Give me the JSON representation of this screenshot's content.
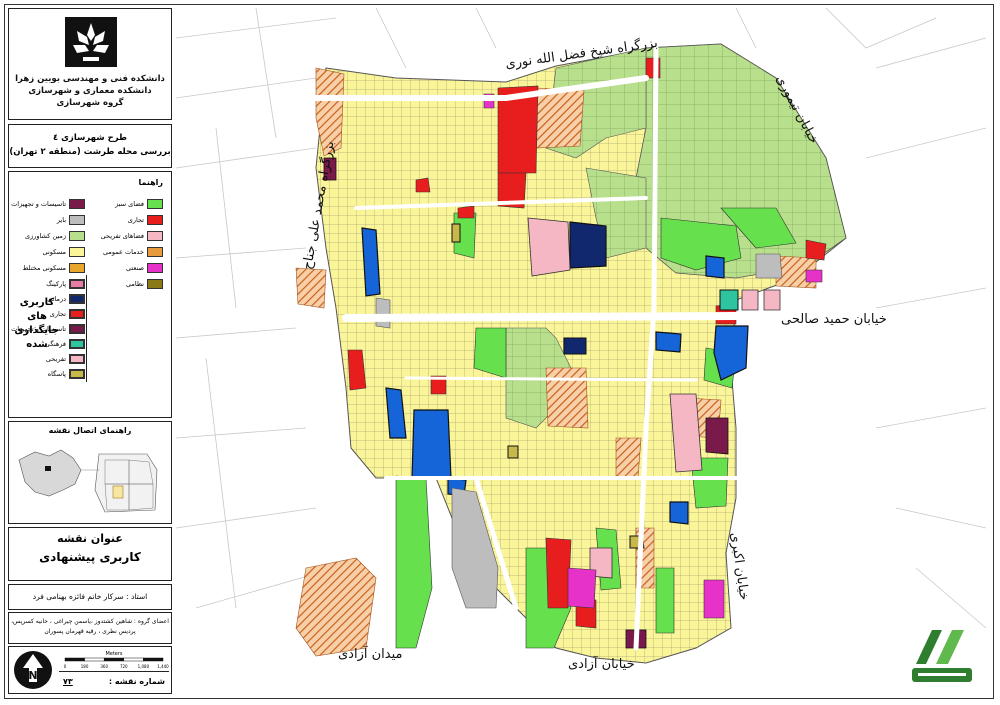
{
  "header": {
    "line1": "دانشکده فنی و مهندسی بویین زهرا",
    "line2": "دانشکده معماری و شهرسازی",
    "line3": "گروه شهرسازی"
  },
  "project": {
    "line1": "طرح شهرسازی ٤",
    "line2": "بررسی محله طرشت (منطقه ۲ تهران)"
  },
  "legend": {
    "title": "راهنما",
    "items": [
      {
        "label": "فضای سبز",
        "color": "#66e04c"
      },
      {
        "label": "تاسیسات و تجهیزات",
        "color": "#7a1a4a"
      },
      {
        "label": "تجاری",
        "color": "#e81e1e"
      },
      {
        "label": "بایر",
        "color": "#bdbdbd"
      },
      {
        "label": "فضاهای تفریحی",
        "color": "#f6b7c4"
      },
      {
        "label": "زمین کشاورزی",
        "color": "#b8e08c"
      },
      {
        "label": "خدمات عمومی",
        "color": "#e89a3c"
      },
      {
        "label": "مسکونی",
        "color": "#fbf59a"
      },
      {
        "label": "صنعتی",
        "color": "#e632c8"
      },
      {
        "label": "مسکونی مختلط",
        "color": "#e8a62c"
      },
      {
        "label": "نظامی",
        "color": "#8a7a16"
      }
    ],
    "proposed_items": [
      {
        "label": "پارکینگ",
        "color": "#e87aa6"
      },
      {
        "label": "درمانی",
        "color": "#12286e"
      },
      {
        "label": "تجاری",
        "color": "#e81e1e"
      },
      {
        "label": "تاسیسات و تجهیزات",
        "color": "#7a1a4a"
      },
      {
        "label": "فرهنگی",
        "color": "#2ec4a0"
      },
      {
        "label": "تفریحی",
        "color": "#f6b7c4"
      },
      {
        "label": "پاسگاه",
        "color": "#c8b84a"
      }
    ],
    "group_label": "کاربری های جایگذاری شده"
  },
  "index_map": {
    "title": "راهنمای اتصال نقشه"
  },
  "map_title": {
    "label": "عنوان نقشه",
    "value": "کاربری پیشنهادی"
  },
  "instructor": {
    "text": "استاد : سرکار خانم فائزه بهنامی فرد"
  },
  "members": {
    "line1": "اعضای گروه : شاهین کشتدوز ،یاسمن چیراغی ، حانیه کسرپس،",
    "line2": "پردیس نظری ، رقیه قهرمان پسوران"
  },
  "scale": {
    "unit": "Meters",
    "ticks": [
      "0",
      "180",
      "360",
      "720",
      "1,080",
      "1,440"
    ]
  },
  "north_arrow": {
    "label": "N"
  },
  "sheet": {
    "label": "شماره نقشه :",
    "value": "٧٣"
  },
  "streets": {
    "north": "بزرگراه شیخ فضل الله نوری",
    "northeast": "خیابان تیموری",
    "east_mid": "خیابان حمید صالحی",
    "east_south": "خیابان اکبری",
    "west": "بزرگراه محمد علی جناح",
    "south": "خیابان آزادی",
    "southwest": "میدان آزادی"
  },
  "colors": {
    "green": "#66e04c",
    "agri": "#b8e08c",
    "residential": "#fbf59a",
    "commercial": "#e81e1e",
    "blue_medical": "#1565d8",
    "navy": "#12286e",
    "pink": "#f6b7c4",
    "magenta": "#e632c8",
    "barren": "#bdbdbd",
    "service_hatch": "#e07a2c"
  }
}
